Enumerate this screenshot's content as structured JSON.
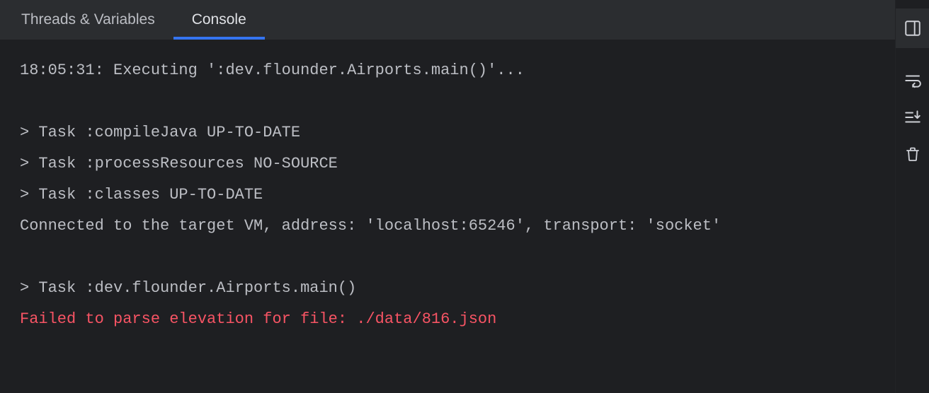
{
  "tabs": {
    "threads": "Threads & Variables",
    "console": "Console"
  },
  "console": {
    "lines": [
      {
        "text": "18:05:31: Executing ':dev.flounder.Airports.main()'...",
        "cls": "status-line"
      },
      {
        "text": "",
        "cls": ""
      },
      {
        "text": "> Task :compileJava UP-TO-DATE",
        "cls": ""
      },
      {
        "text": "> Task :processResources NO-SOURCE",
        "cls": ""
      },
      {
        "text": "> Task :classes UP-TO-DATE",
        "cls": ""
      },
      {
        "text": "Connected to the target VM, address: 'localhost:65246', transport: 'socket'",
        "cls": ""
      },
      {
        "text": "",
        "cls": ""
      },
      {
        "text": "> Task :dev.flounder.Airports.main()",
        "cls": ""
      },
      {
        "text": "Failed to parse elevation for file: ./data/816.json",
        "cls": "error"
      }
    ]
  }
}
